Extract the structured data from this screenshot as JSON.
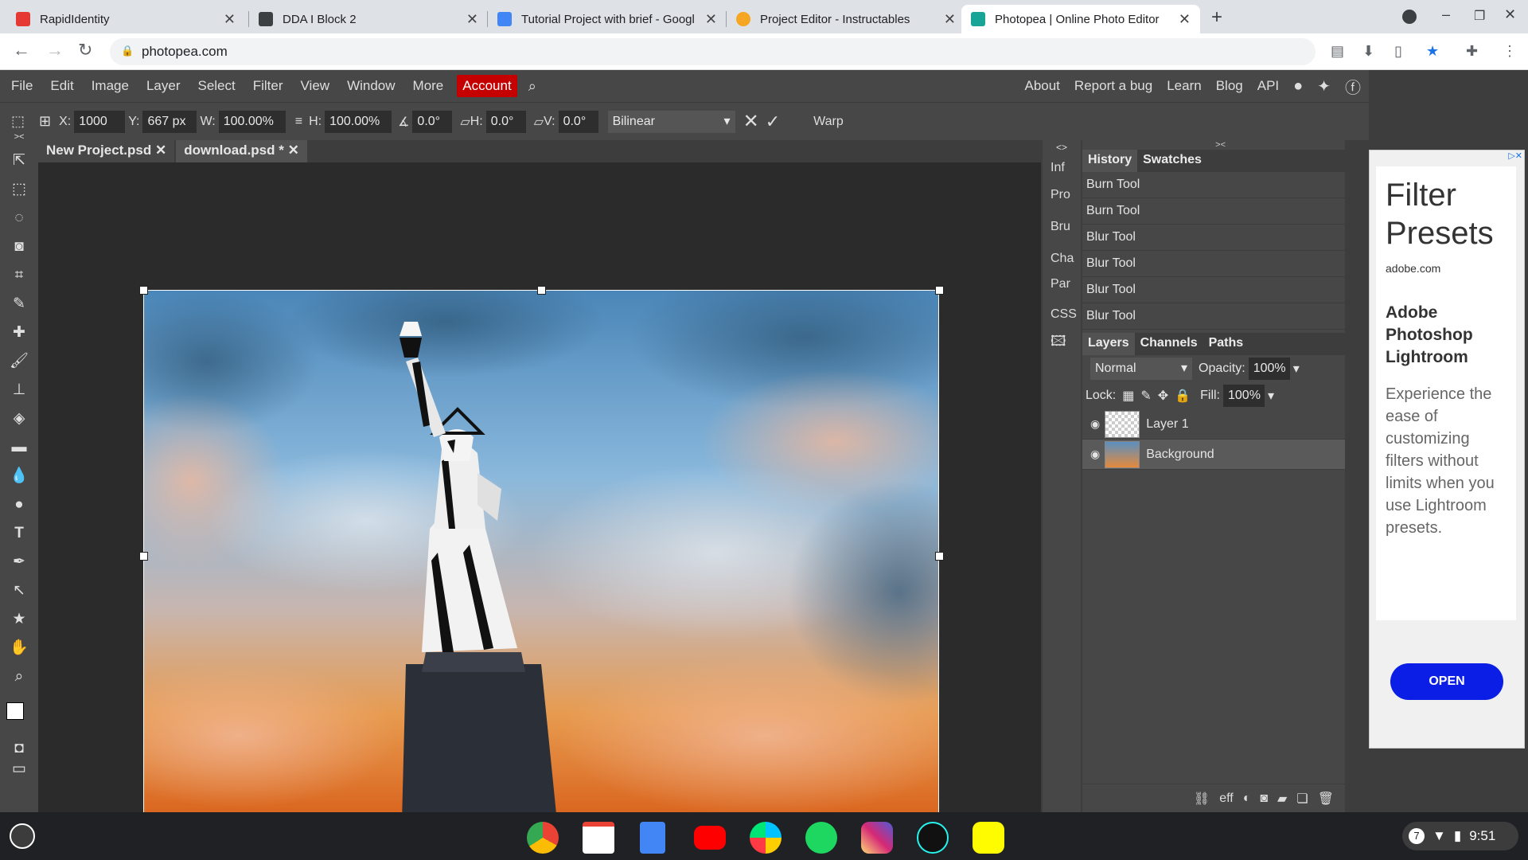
{
  "browser": {
    "tabs": [
      {
        "title": "RapidIdentity",
        "icon": "rapididentity-icon",
        "color": "#e53935"
      },
      {
        "title": "DDA I Block 2",
        "icon": "classroom-icon",
        "color": "#3c4043"
      },
      {
        "title": "Tutorial Project with brief - Googl",
        "icon": "docs-icon",
        "color": "#4285f4"
      },
      {
        "title": "Project Editor - Instructables",
        "icon": "instructables-icon",
        "color": "#f5a623"
      },
      {
        "title": "Photopea | Online Photo Editor",
        "icon": "photopea-icon",
        "color": "#18a497"
      }
    ],
    "url": "photopea.com"
  },
  "menu": {
    "items": [
      "File",
      "Edit",
      "Image",
      "Layer",
      "Select",
      "Filter",
      "View",
      "Window",
      "More"
    ],
    "account": "Account",
    "right": [
      "About",
      "Report a bug",
      "Learn",
      "Blog",
      "API"
    ]
  },
  "options": {
    "x_label": "X:",
    "x": "1000 px",
    "y_label": "Y:",
    "y": "667 px",
    "w_label": "W:",
    "w": "100.00%",
    "h_label": "H:",
    "h": "100.00%",
    "angle": "0.0°",
    "skew_h_label": "H:",
    "skew_h": "0.0°",
    "skew_v_label": "V:",
    "skew_v": "0.0°",
    "interp": "Bilinear",
    "warp": "Warp"
  },
  "doc_tabs": [
    "New Project.psd",
    "download.psd *"
  ],
  "mini_panels": [
    "Inf",
    "Pro",
    "Bru",
    "Cha",
    "Par",
    "CSS"
  ],
  "history": {
    "tabs": [
      "History",
      "Swatches"
    ],
    "items": [
      "Burn Tool",
      "Burn Tool",
      "Blur Tool",
      "Blur Tool",
      "Blur Tool",
      "Blur Tool"
    ]
  },
  "layers": {
    "tabs": [
      "Layers",
      "Channels",
      "Paths"
    ],
    "blend": "Normal",
    "opacity_label": "Opacity:",
    "opacity": "100%",
    "lock_label": "Lock:",
    "fill_label": "Fill:",
    "fill": "100%",
    "list": [
      "Layer 1",
      "Background"
    ],
    "footer": [
      "link-icon",
      "eff",
      "adjustment-icon",
      "mask-icon",
      "folder-icon",
      "new-layer-icon",
      "trash-icon"
    ]
  },
  "ad": {
    "headline": "Filter Presets",
    "domain": "adobe.com",
    "title": "Adobe Photoshop Lightroom",
    "body": "Experience the ease of customizing filters without limits when you use Lightroom presets.",
    "cta": "OPEN"
  },
  "shelf": {
    "badge": "7",
    "time": "9:51"
  }
}
